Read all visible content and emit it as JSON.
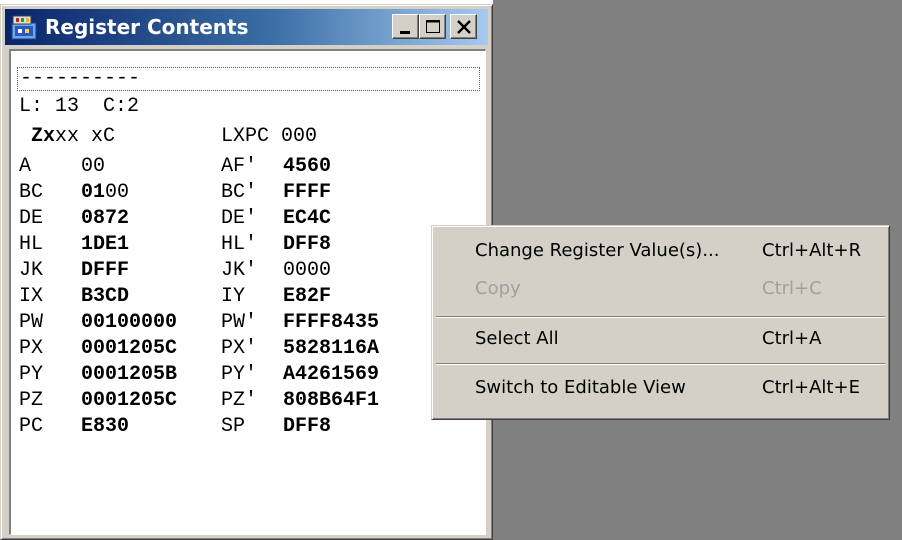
{
  "window": {
    "title": "Register Contents",
    "icon": "register-app-icon",
    "controls": [
      "minimize-icon",
      "maximize-icon",
      "close-icon"
    ]
  },
  "status_line": "----------",
  "position": {
    "text": "L: 13  C:2"
  },
  "flags": {
    "bold_part": "Zx",
    "rest": "xx xC"
  },
  "lxpc": {
    "label": "LXPC",
    "value": "000"
  },
  "registers": [
    {
      "n1": "A",
      "v1a": "",
      "v1b": "00",
      "n2": "AF'",
      "v2": "4560",
      "v2bold": true
    },
    {
      "n1": "BC",
      "v1a": "01",
      "v1b": "00",
      "n2": "BC'",
      "v2": "FFFF",
      "v2bold": true
    },
    {
      "n1": "DE",
      "v1a": "0872",
      "v1b": "",
      "n2": "DE'",
      "v2": "EC4C",
      "v2bold": true
    },
    {
      "n1": "HL",
      "v1a": "1DE1",
      "v1b": "",
      "n2": "HL'",
      "v2": "DFF8",
      "v2bold": true
    },
    {
      "n1": "JK",
      "v1a": "DFFF",
      "v1b": "",
      "n2": "JK'",
      "v2": "0000",
      "v2bold": false
    },
    {
      "n1": "IX",
      "v1a": "B3CD",
      "v1b": "",
      "n2": "IY",
      "v2": "E82F",
      "v2bold": true
    },
    {
      "n1": "PW",
      "v1a": "00100000",
      "v1b": "",
      "n2": "PW'",
      "v2": "FFFF8435",
      "v2bold": true
    },
    {
      "n1": "PX",
      "v1a": "0001205C",
      "v1b": "",
      "n2": "PX'",
      "v2": "5828116A",
      "v2bold": true
    },
    {
      "n1": "PY",
      "v1a": "0001205B",
      "v1b": "",
      "n2": "PY'",
      "v2": "A4261569",
      "v2bold": true
    },
    {
      "n1": "PZ",
      "v1a": "0001205C",
      "v1b": "",
      "n2": "PZ'",
      "v2": "808B64F1",
      "v2bold": true
    },
    {
      "n1": "PC",
      "v1a": "E830",
      "v1b": "",
      "n2": "SP",
      "v2": "DFF8",
      "v2bold": true
    }
  ],
  "context_menu": {
    "items": [
      {
        "label": "Change Register Value(s)...",
        "shortcut": "Ctrl+Alt+R",
        "enabled": true
      },
      {
        "label": "Copy",
        "shortcut": "Ctrl+C",
        "enabled": false
      },
      {
        "label": "Select All",
        "shortcut": "Ctrl+A",
        "enabled": true
      },
      {
        "label": "Switch to Editable View",
        "shortcut": "Ctrl+Alt+E",
        "enabled": true
      }
    ]
  },
  "colors": {
    "titlebar_start": "#0a246a",
    "titlebar_end": "#a6caf0",
    "chrome": "#d4d0c8",
    "desktop": "#808080"
  }
}
